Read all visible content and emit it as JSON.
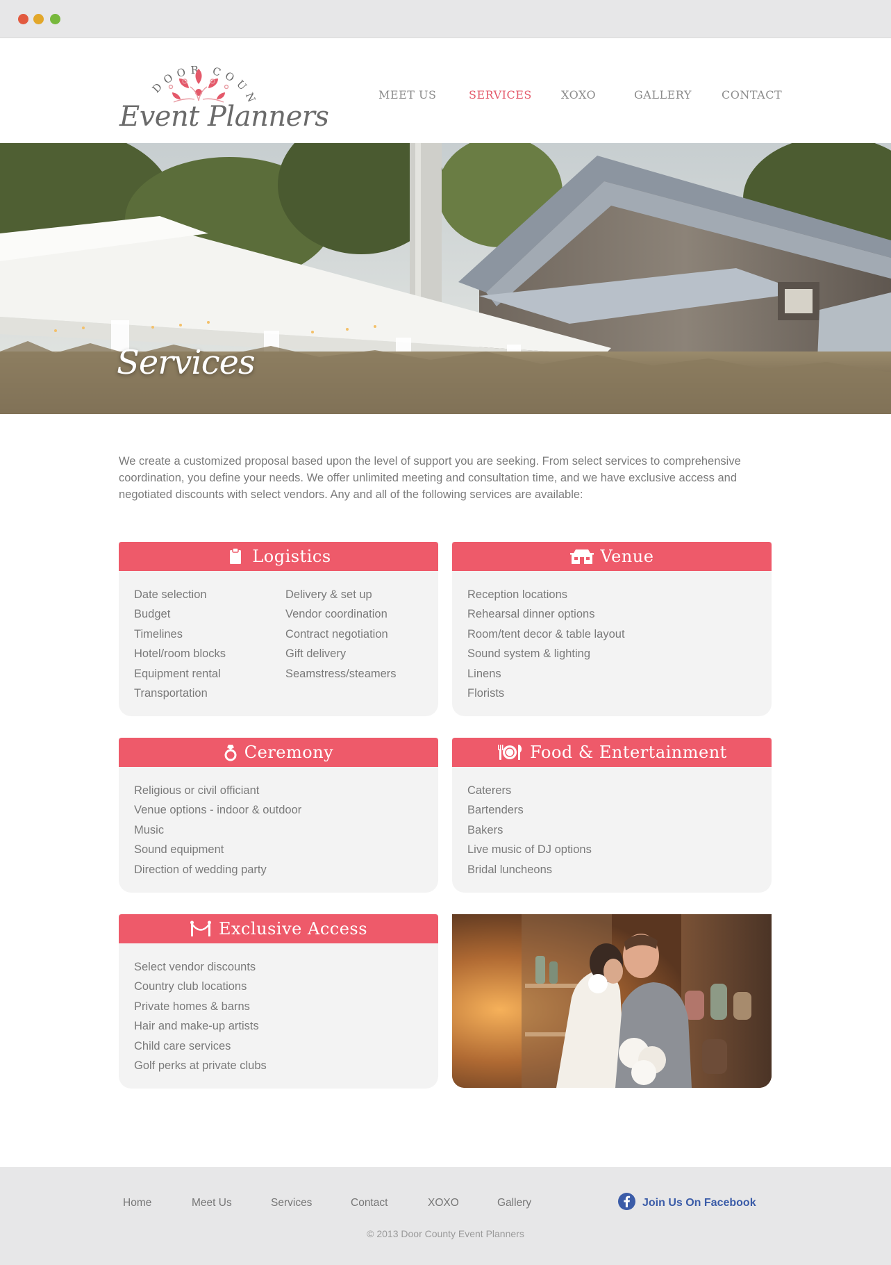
{
  "browser": {
    "controls": [
      "close",
      "minimize",
      "maximize"
    ]
  },
  "logo": {
    "top_text": "DOOR COUNTY",
    "main_text": "Event Planners"
  },
  "nav": {
    "items": [
      {
        "label": "MEET US"
      },
      {
        "label": "SERVICES",
        "active": true
      },
      {
        "label": "XOXO"
      },
      {
        "label": "GALLERY"
      },
      {
        "label": "CONTACT"
      }
    ]
  },
  "hero": {
    "title": "Services"
  },
  "intro": "We create a customized proposal based upon the level of support you are seeking. From select services to comprehensive coordination, you define your needs. We offer unlimited meeting and consultation time, and we have exclusive access and negotiated discounts with select vendors. Any and all of the following services are available:",
  "cards": {
    "logistics": {
      "title": "Logistics",
      "icon": "clipboard-icon",
      "col1": [
        "Date selection",
        "Budget",
        "Timelines",
        "Hotel/room blocks",
        "Equipment rental",
        "Transportation"
      ],
      "col2": [
        "Delivery & set up",
        "Vendor coordination",
        "Contract negotiation",
        "Gift delivery",
        "Seamstress/steamers"
      ]
    },
    "venue": {
      "title": "Venue",
      "icon": "building-icon",
      "items": [
        "Reception locations",
        "Rehearsal dinner options",
        "Room/tent decor & table layout",
        "Sound system & lighting",
        "Linens",
        "Florists"
      ]
    },
    "ceremony": {
      "title": "Ceremony",
      "icon": "ring-icon",
      "items": [
        "Religious or civil officiant",
        "Venue options - indoor & outdoor",
        "Music",
        "Sound equipment",
        "Direction of wedding party"
      ]
    },
    "food": {
      "title": "Food & Entertainment",
      "icon": "plate-cutlery-icon",
      "items": [
        "Caterers",
        "Bartenders",
        "Bakers",
        "Live music of DJ options",
        "Bridal luncheons"
      ]
    },
    "exclusive": {
      "title": "Exclusive Access",
      "icon": "rope-barrier-icon",
      "items": [
        "Select vendor discounts",
        "Country club locations",
        "Private homes & barns",
        "Hair and make-up artists",
        "Child care services",
        "Golf perks at private clubs"
      ]
    }
  },
  "footer": {
    "links": [
      "Home",
      "Meet Us",
      "Services",
      "Contact",
      "XOXO",
      "Gallery"
    ],
    "facebook": "Join Us On Facebook",
    "copyright": "© 2013 Door County Event Planners"
  },
  "colors": {
    "accent": "#ee5a6a",
    "nav_active": "#e4596a",
    "card_bg": "#f3f3f3",
    "facebook": "#3b5ca8"
  }
}
